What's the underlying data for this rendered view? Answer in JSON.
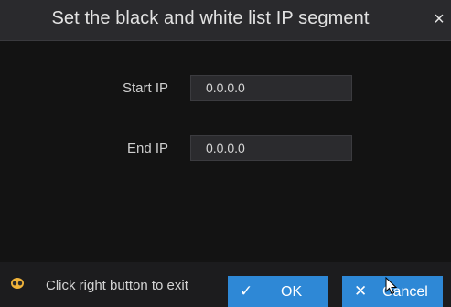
{
  "dialog": {
    "title": "Set the black and white list IP segment",
    "close_symbol": "×"
  },
  "form": {
    "start_ip": {
      "label": "Start IP",
      "value": "0.0.0.0"
    },
    "end_ip": {
      "label": "End IP",
      "value": "0.0.0.0"
    }
  },
  "footer": {
    "hint_icon": "mouse-icon",
    "hint_text": "Click right button to exit",
    "ok_icon": "check-icon",
    "ok_symbol": "✓",
    "ok_label": "OK",
    "cancel_icon": "close-icon",
    "cancel_symbol": "✕",
    "cancel_label": "Cancel"
  },
  "colors": {
    "accent": "#2e88d6",
    "background": "#141414",
    "title_bar": "#2a2a2d",
    "input_bg": "#2b2b2e"
  }
}
